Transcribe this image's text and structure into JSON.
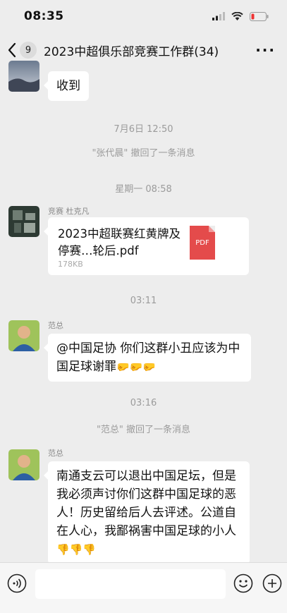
{
  "status_bar": {
    "time": "08:35"
  },
  "header": {
    "back_count": "9",
    "title": "2023中超俱乐部竞赛工作群(34)",
    "more_label": "···"
  },
  "messages": [
    {
      "type": "text",
      "text": "收到"
    },
    {
      "type": "time",
      "text": "7月6日 12:50"
    },
    {
      "type": "system",
      "text": "\"张代晨\" 撤回了一条消息"
    },
    {
      "type": "time",
      "text": "星期一 08:58"
    },
    {
      "type": "file",
      "sender": "竞赛 杜克凡",
      "file_name": "2023中超联赛红黄牌及停赛…轮后.pdf",
      "file_size": "178KB",
      "file_icon": "PDF"
    },
    {
      "type": "time",
      "text": "03:11"
    },
    {
      "type": "text",
      "sender": "范总",
      "text": "@中国足协 你们这群小丑应该为中国足球谢罪",
      "emoji": "🤛🤛🤛"
    },
    {
      "type": "time",
      "text": "03:16"
    },
    {
      "type": "system",
      "text": "\"范总\" 撤回了一条消息"
    },
    {
      "type": "text",
      "sender": "范总",
      "text": "南通支云可以退出中国足坛，但是我必须声讨你们这群中国足球的恶人！历史留给后人去评述。公道自在人心，我鄙祸害中国足球的小人",
      "emoji": "👎👎👎"
    }
  ],
  "input_bar": {
    "placeholder": ""
  }
}
